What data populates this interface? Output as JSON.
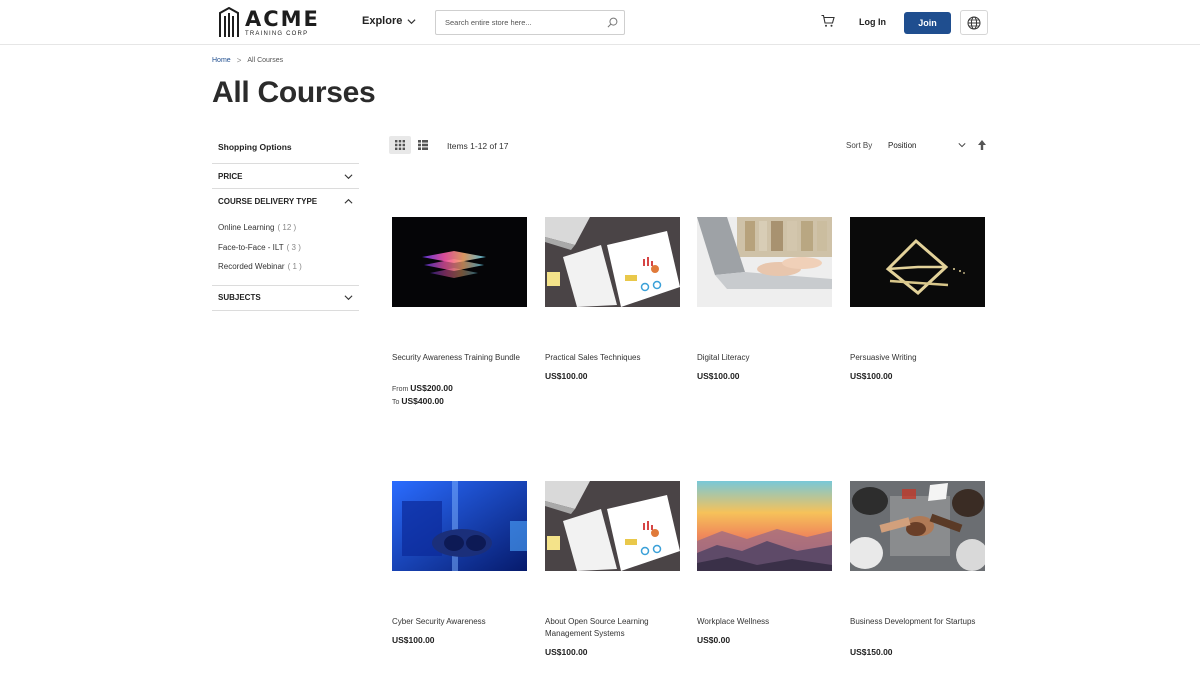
{
  "header": {
    "logo_main": "ACME",
    "logo_sub": "TRAINING CORP",
    "explore_label": "Explore",
    "search_placeholder": "Search entire store here...",
    "login_label": "Log In",
    "join_label": "Join",
    "accent_color": "#1f4e8f"
  },
  "breadcrumb": {
    "home": "Home",
    "separator": ">",
    "current": "All Courses"
  },
  "page_title": "All Courses",
  "sidebar": {
    "title": "Shopping Options",
    "filters": [
      {
        "label": "PRICE",
        "expanded": false
      },
      {
        "label": "COURSE DELIVERY TYPE",
        "expanded": true,
        "options": [
          {
            "label": "Online Learning",
            "count": "( 12 )"
          },
          {
            "label": "Face-to-Face - ILT",
            "count": "( 3 )"
          },
          {
            "label": "Recorded Webinar",
            "count": "( 1 )"
          }
        ]
      },
      {
        "label": "SUBJECTS",
        "expanded": false
      }
    ]
  },
  "toolbar": {
    "items_text": "Items 1-12 of 17",
    "sort_label": "Sort By",
    "sort_value": "Position"
  },
  "products": [
    {
      "name": "Security Awareness Training Bundle",
      "price": "",
      "from_label": "From",
      "from_price": "US$200.00",
      "to_label": "To",
      "to_price": "US$400.00",
      "image": "holographic-laptop"
    },
    {
      "name": "Practical Sales Techniques",
      "price": "US$100.00",
      "image": "desk-notebook-charts"
    },
    {
      "name": "Digital Literacy",
      "price": "US$100.00",
      "image": "typing-laptop"
    },
    {
      "name": "Persuasive Writing",
      "price": "US$100.00",
      "image": "paperclip-envelope"
    },
    {
      "name": "Cyber Security Awareness",
      "price": "US$100.00",
      "image": "blue-vr-headset"
    },
    {
      "name": "About Open Source Learning Management Systems",
      "price": "US$100.00",
      "image": "desk-notebook-charts"
    },
    {
      "name": "Workplace Wellness",
      "price": "US$0.00",
      "image": "sunset-mountains"
    },
    {
      "name": "Business Development for Startups",
      "price": "US$150.00",
      "image": "team-hands-together"
    }
  ]
}
